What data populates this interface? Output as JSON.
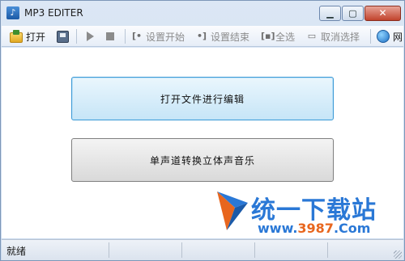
{
  "window": {
    "title": "MP3 EDITER",
    "app_icon": "mp3-app-icon"
  },
  "toolbar": {
    "open_label": "打开",
    "set_start_label": "设置开始",
    "set_end_label": "设置结束",
    "select_all_label": "全选",
    "deselect_label": "取消选择",
    "web_label": "网",
    "icons": [
      "folder-open-icon",
      "save-icon",
      "play-icon",
      "stop-icon",
      "set-start-icon",
      "set-end-icon",
      "select-all-icon",
      "deselect-icon",
      "globe-icon"
    ]
  },
  "main": {
    "open_edit_label": "打开文件进行编辑",
    "mono_to_stereo_label": "单声道转换立体声音乐"
  },
  "watermark": {
    "brand": "统一下载站",
    "url_prefix": "www.",
    "url_highlight": "3987",
    "url_suffix": ".Com"
  },
  "status": {
    "text": "就绪"
  },
  "colors": {
    "accent_button_border": "#3c9ad6",
    "watermark_blue": "#2a78d6",
    "watermark_orange": "#e8661e"
  }
}
